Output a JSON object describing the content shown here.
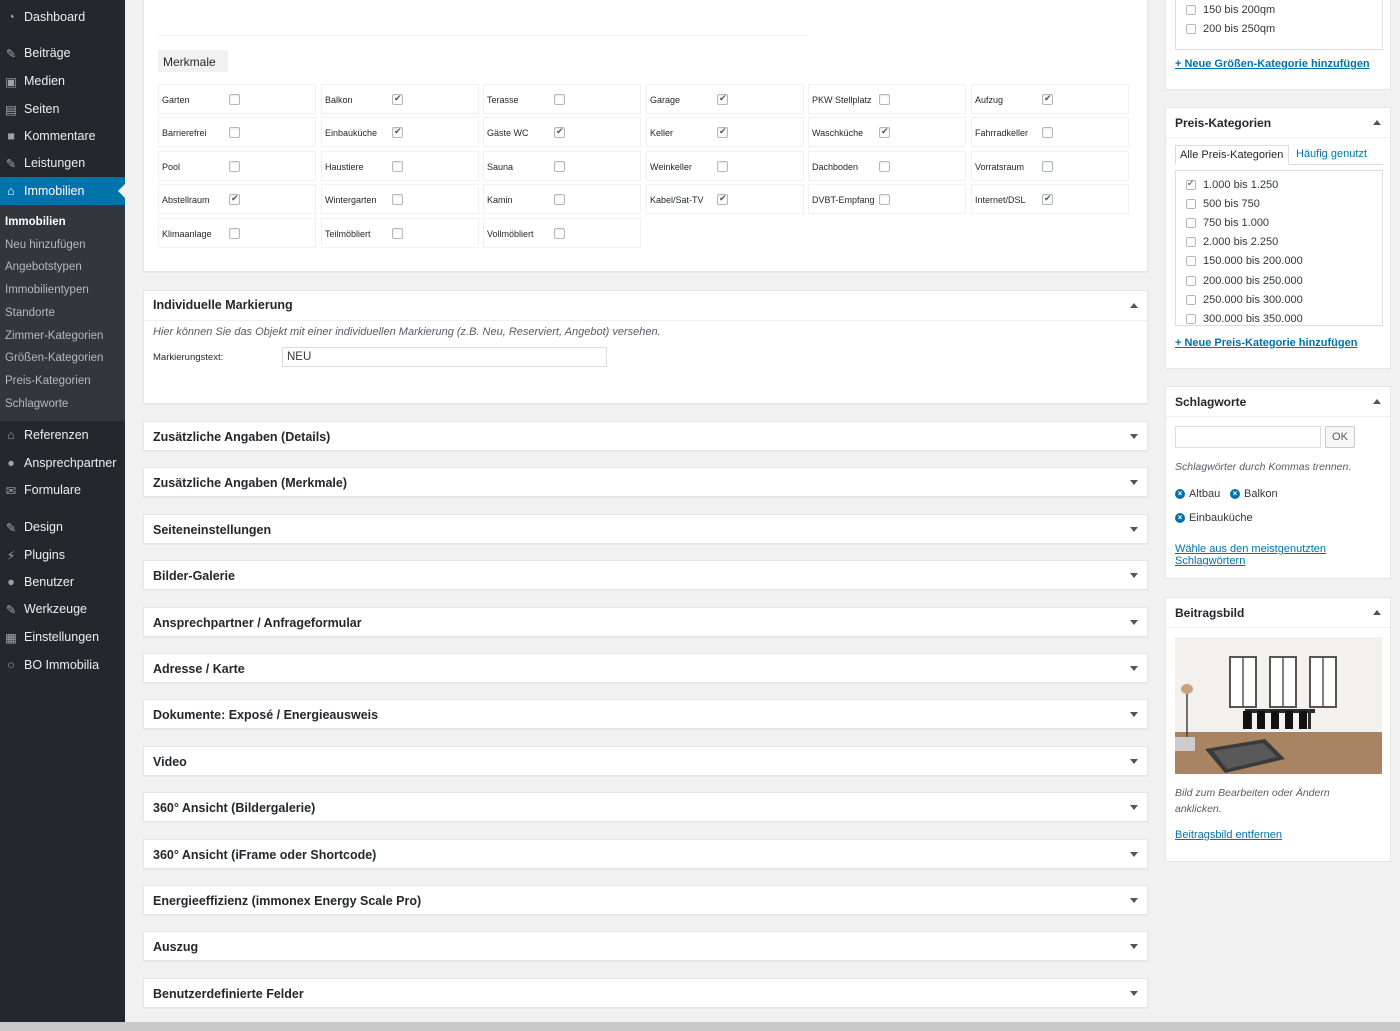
{
  "sidebar": {
    "menu": [
      {
        "label": "Dashboard",
        "icon": "dashboard-icon"
      },
      {
        "label": "Beiträge",
        "icon": "pin-icon"
      },
      {
        "label": "Medien",
        "icon": "media-icon"
      },
      {
        "label": "Seiten",
        "icon": "pages-icon"
      },
      {
        "label": "Kommentare",
        "icon": "comment-icon"
      },
      {
        "label": "Leistungen",
        "icon": "edit-icon"
      },
      {
        "label": "Immobilien",
        "icon": "home-icon"
      }
    ],
    "submenu": [
      "Immobilien",
      "Neu hinzufügen",
      "Angebotstypen",
      "Immobilientypen",
      "Standorte",
      "Zimmer-Kategorien",
      "Größen-Kategorien",
      "Preis-Kategorien",
      "Schlagworte"
    ],
    "menu2": [
      {
        "label": "Referenzen",
        "icon": "home-icon"
      },
      {
        "label": "Ansprechpartner",
        "icon": "user-icon"
      },
      {
        "label": "Formulare",
        "icon": "mail-icon"
      }
    ],
    "menu3": [
      {
        "label": "Design",
        "icon": "brush-icon"
      },
      {
        "label": "Plugins",
        "icon": "plugin-icon"
      },
      {
        "label": "Benutzer",
        "icon": "user-icon"
      },
      {
        "label": "Werkzeuge",
        "icon": "wrench-icon"
      },
      {
        "label": "Einstellungen",
        "icon": "settings-icon"
      },
      {
        "label": "BO Immobilia",
        "icon": "circle-icon"
      }
    ]
  },
  "merkmale": {
    "tab_label": "Merkmale",
    "rows": [
      [
        {
          "l": "Garten",
          "c": false
        },
        {
          "l": "Balkon",
          "c": true
        },
        {
          "l": "Terasse",
          "c": false
        },
        {
          "l": "Garage",
          "c": true
        },
        {
          "l": "PKW Stellplatz",
          "c": false
        },
        {
          "l": "Aufzug",
          "c": true
        }
      ],
      [
        {
          "l": "Barrierefrei",
          "c": false
        },
        {
          "l": "Einbauküche",
          "c": true
        },
        {
          "l": "Gäste WC",
          "c": true
        },
        {
          "l": "Keller",
          "c": true
        },
        {
          "l": "Waschküche",
          "c": true
        },
        {
          "l": "Fahrradkeller",
          "c": false
        }
      ],
      [
        {
          "l": "Pool",
          "c": false
        },
        {
          "l": "Haustiere",
          "c": false
        },
        {
          "l": "Sauna",
          "c": false
        },
        {
          "l": "Weinkeller",
          "c": false
        },
        {
          "l": "Dachboden",
          "c": false
        },
        {
          "l": "Vorratsraum",
          "c": false
        }
      ],
      [
        {
          "l": "Abstellraum",
          "c": true
        },
        {
          "l": "Wintergarten",
          "c": false
        },
        {
          "l": "Kamin",
          "c": false
        },
        {
          "l": "Kabel/Sat-TV",
          "c": true
        },
        {
          "l": "DVBT-Empfang",
          "c": false
        },
        {
          "l": "Internet/DSL",
          "c": true
        }
      ],
      [
        {
          "l": "Klimaanlage",
          "c": false
        },
        {
          "l": "Teilmöbliert",
          "c": false
        },
        {
          "l": "Vollmöbliert",
          "c": false
        }
      ]
    ]
  },
  "markierung": {
    "title": "Individuelle Markierung",
    "hint": "Hier können Sie das Objekt mit einer individuellen Markierung (z.B. Neu, Reserviert, Angebot) versehen.",
    "label": "Markierungstext:",
    "value": "NEU"
  },
  "panels": [
    "Zusätzliche Angaben (Details)",
    "Zusätzliche Angaben (Merkmale)",
    "Seiteneinstellungen",
    "Bilder-Galerie",
    "Ansprechpartner / Anfrageformular",
    "Adresse / Karte",
    "Dokumente: Exposé / Energieausweis",
    "Video",
    "360° Ansicht (Bildergalerie)",
    "360° Ansicht (iFrame oder Shortcode)",
    "Energieeffizienz (immonex Energy Scale Pro)",
    "Auszug",
    "Benutzerdefinierte Felder"
  ],
  "groessen": {
    "items": [
      {
        "l": "150 bis 200qm",
        "c": false
      },
      {
        "l": "200 bis 250qm",
        "c": false
      }
    ],
    "add_link": "+ Neue Größen-Kategorie hinzufügen"
  },
  "preis": {
    "title": "Preis-Kategorien",
    "tab_all": "Alle Preis-Kategorien",
    "tab_popular": "Häufig genutzt",
    "items": [
      {
        "l": "1.000 bis 1.250",
        "c": true
      },
      {
        "l": "500 bis 750",
        "c": false
      },
      {
        "l": "750 bis 1.000",
        "c": false
      },
      {
        "l": "2.000 bis 2.250",
        "c": false
      },
      {
        "l": "150.000 bis 200.000",
        "c": false
      },
      {
        "l": "200.000 bis 250.000",
        "c": false
      },
      {
        "l": "250.000 bis 300.000",
        "c": false
      },
      {
        "l": "300.000 bis 350.000",
        "c": false
      }
    ],
    "add_link": "+ Neue Preis-Kategorie hinzufügen"
  },
  "schlagworte": {
    "title": "Schlagworte",
    "ok": "OK",
    "hint": "Schlagwörter durch Kommas trennen.",
    "tags": [
      "Altbau",
      "Balkon",
      "Einbauküche"
    ],
    "choose_link_1": "Wähle aus den meistgenutzten",
    "choose_link_2": "Schlagwörtern"
  },
  "beitragsbild": {
    "title": "Beitragsbild",
    "hint_1": "Bild zum Bearbeiten oder Ändern",
    "hint_2": "anklicken.",
    "remove_link": "Beitragsbild entfernen"
  }
}
